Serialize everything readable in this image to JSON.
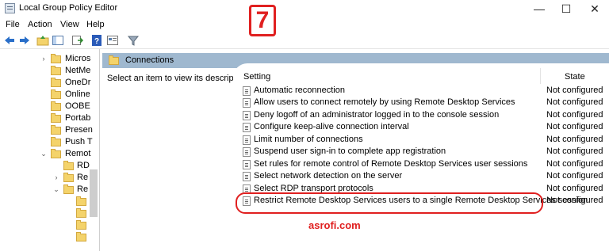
{
  "window": {
    "title": "Local Group Policy Editor",
    "minimize": "—",
    "maximize": "☐",
    "close": "✕"
  },
  "menu": [
    "File",
    "Action",
    "View",
    "Help"
  ],
  "tree": {
    "items": [
      {
        "label": "Micros",
        "chevron": "›"
      },
      {
        "label": "NetMe",
        "chevron": ""
      },
      {
        "label": "OneDr",
        "chevron": ""
      },
      {
        "label": "Online",
        "chevron": ""
      },
      {
        "label": "OOBE",
        "chevron": ""
      },
      {
        "label": "Portab",
        "chevron": ""
      },
      {
        "label": "Presen",
        "chevron": ""
      },
      {
        "label": "Push T",
        "chevron": ""
      },
      {
        "label": "Remot",
        "chevron": "⌄"
      },
      {
        "label": "RD",
        "chevron": ""
      },
      {
        "label": "Re",
        "chevron": "›"
      },
      {
        "label": "Re",
        "chevron": "⌄"
      },
      {
        "label": "",
        "chevron": ""
      },
      {
        "label": "",
        "chevron": ""
      },
      {
        "label": "",
        "chevron": ""
      },
      {
        "label": "",
        "chevron": ""
      }
    ]
  },
  "content": {
    "header_title": "Connections",
    "description": "Select an item to view its description.",
    "columns": {
      "setting": "Setting",
      "state": "State"
    },
    "rows": [
      {
        "setting": "Automatic reconnection",
        "state": "Not configured"
      },
      {
        "setting": "Allow users to connect remotely by using Remote Desktop Services",
        "state": "Not configured"
      },
      {
        "setting": "Deny logoff of an administrator logged in to the console session",
        "state": "Not configured"
      },
      {
        "setting": "Configure keep-alive connection interval",
        "state": "Not configured"
      },
      {
        "setting": "Limit number of connections",
        "state": "Not configured"
      },
      {
        "setting": "Suspend user sign-in to complete app registration",
        "state": "Not configured"
      },
      {
        "setting": "Set rules for remote control of Remote Desktop Services user sessions",
        "state": "Not configured"
      },
      {
        "setting": "Select network detection on the server",
        "state": "Not configured"
      },
      {
        "setting": "Select RDP transport protocols",
        "state": "Not configured"
      },
      {
        "setting": "Restrict Remote Desktop Services users to a single Remote Desktop Services session",
        "state": "Not configured"
      }
    ]
  },
  "overlay": {
    "step_number": "7",
    "watermark": "asrofi.com",
    "accent_color": "#e02020"
  },
  "icons": [
    "back-arrow-icon",
    "forward-arrow-icon",
    "up-folder-icon",
    "show-hide-tree-icon",
    "export-list-icon",
    "help-icon",
    "properties-icon",
    "filter-icon"
  ]
}
